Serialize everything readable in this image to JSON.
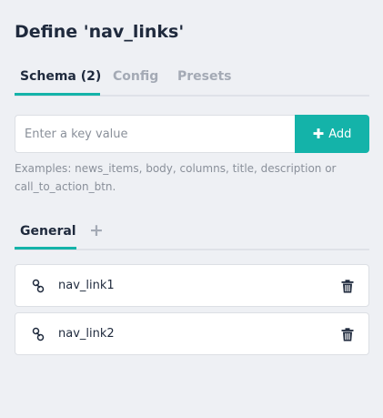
{
  "title": "Define 'nav_links'",
  "tabs": [
    {
      "label": "Schema (2)",
      "active": true
    },
    {
      "label": "Config",
      "active": false
    },
    {
      "label": "Presets",
      "active": false
    }
  ],
  "key_input": {
    "placeholder": "Enter a key value",
    "value": ""
  },
  "add_button": {
    "icon": "plus-icon",
    "label": "Add"
  },
  "hint": "Examples: news_items, body, columns, title, description or call_to_action_btn.",
  "sub_tabs": [
    {
      "label": "General",
      "active": true
    }
  ],
  "add_tab_label": "+",
  "items": [
    {
      "icon": "link-icon",
      "name": "nav_link1",
      "action_icon": "trash-icon"
    },
    {
      "icon": "link-icon",
      "name": "nav_link2",
      "action_icon": "trash-icon"
    }
  ],
  "colors": {
    "accent": "#14b3a9",
    "background": "#eef0f4",
    "text": "#1f2a3d",
    "muted": "#a4aab5"
  }
}
